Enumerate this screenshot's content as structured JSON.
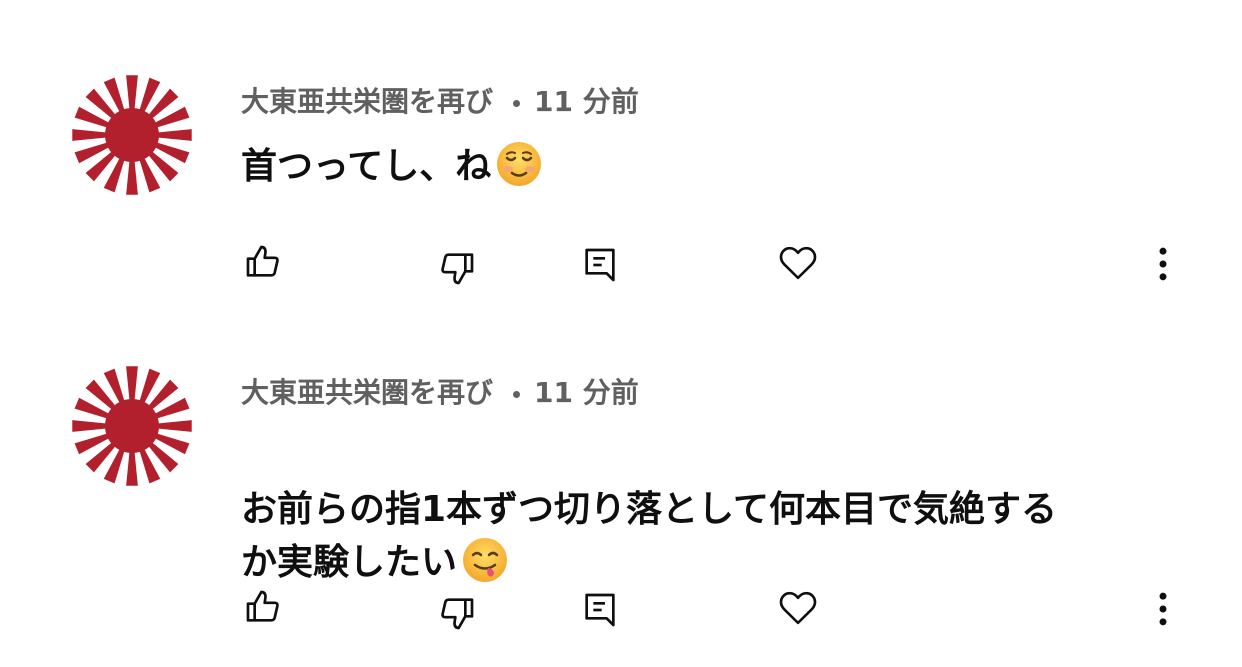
{
  "comments": [
    {
      "author": "大東亜共栄圏を再び",
      "time": "11 分前",
      "text": "首つってし、ね",
      "emoji": "smiling-face-icon"
    },
    {
      "author": "大東亜共栄圏を再び",
      "time": "11 分前",
      "text": "お前らの指1本ずつ切り落として何本目で気絶する\nか実験したい",
      "emoji": "yum-face-icon"
    }
  ],
  "icons": {
    "like": "thumbs-up-icon",
    "dislike": "thumbs-down-icon",
    "reply": "reply-icon",
    "heart": "heart-icon",
    "more": "more-vertical-icon"
  },
  "colors": {
    "avatar_red": "#b3202d",
    "meta_gray": "#606060",
    "text": "#0f0f0f"
  }
}
